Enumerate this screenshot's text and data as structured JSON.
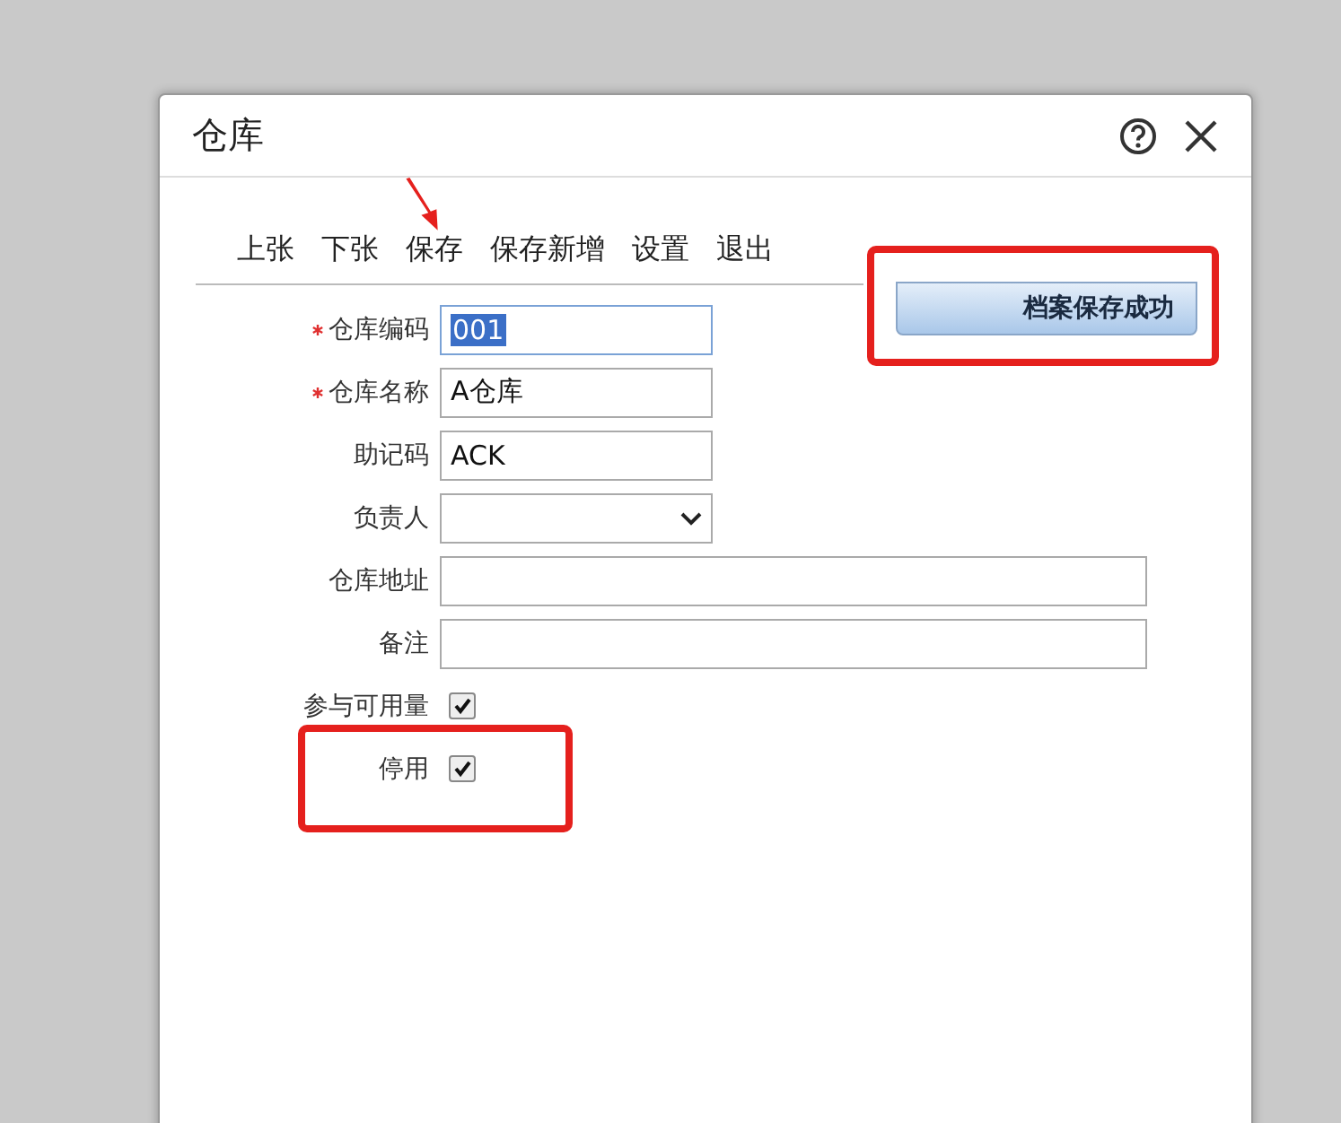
{
  "window": {
    "title": "仓库"
  },
  "toolbar": [
    {
      "label": "上张"
    },
    {
      "label": "下张"
    },
    {
      "label": "保存"
    },
    {
      "label": "保存新增"
    },
    {
      "label": "设置"
    },
    {
      "label": "退出"
    }
  ],
  "toast": {
    "text": "档案保存成功"
  },
  "fields": [
    {
      "kind": "text",
      "label": "仓库编码",
      "required": true,
      "value": "001",
      "focused": true,
      "wide": false
    },
    {
      "kind": "text",
      "label": "仓库名称",
      "required": true,
      "value": "A仓库",
      "focused": false,
      "wide": false
    },
    {
      "kind": "text",
      "label": "助记码",
      "required": false,
      "value": "ACK",
      "focused": false,
      "wide": false
    },
    {
      "kind": "select",
      "label": "负责人",
      "required": false,
      "focused": false,
      "wide": false
    },
    {
      "kind": "text",
      "label": "仓库地址",
      "required": false,
      "focused": false,
      "wide": true
    },
    {
      "kind": "text",
      "label": "备注",
      "required": false,
      "focused": false,
      "wide": true
    },
    {
      "kind": "checkbox",
      "label": "参与可用量",
      "checked": true
    },
    {
      "kind": "checkbox",
      "label": "停用",
      "checked": true
    }
  ]
}
